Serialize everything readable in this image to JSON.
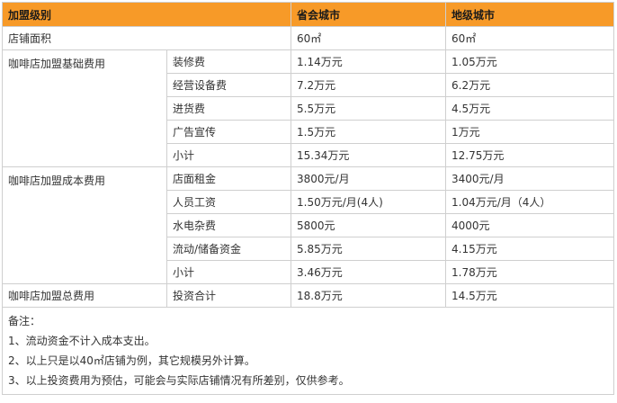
{
  "table": {
    "headers": [
      "加盟级别",
      "",
      "省会城市",
      "地级城市"
    ],
    "area": {
      "label": "店铺面积",
      "provincial": "60㎡",
      "prefecture": "60㎡"
    },
    "groups": [
      {
        "name": "咖啡店加盟基础费用",
        "rows": [
          {
            "item": "装修费",
            "provincial": "1.14万元",
            "prefecture": "1.05万元"
          },
          {
            "item": "经营设备费",
            "provincial": "7.2万元",
            "prefecture": "6.2万元"
          },
          {
            "item": "进货费",
            "provincial": "5.5万元",
            "prefecture": "4.5万元"
          },
          {
            "item": "广告宣传",
            "provincial": "1.5万元",
            "prefecture": "1万元"
          },
          {
            "item": "小计",
            "provincial": "15.34万元",
            "prefecture": "12.75万元"
          }
        ]
      },
      {
        "name": "咖啡店加盟成本费用",
        "rows": [
          {
            "item": "店面租金",
            "provincial": "3800元/月",
            "prefecture": "3400元/月"
          },
          {
            "item": "人员工资",
            "provincial": "1.50万元/月(4人)",
            "prefecture": "1.04万元/月（4人）"
          },
          {
            "item": "水电杂费",
            "provincial": "5800元",
            "prefecture": "4000元"
          },
          {
            "item": "流动/储备资金",
            "provincial": "5.85万元",
            "prefecture": "4.15万元"
          },
          {
            "item": "小计",
            "provincial": "3.46万元",
            "prefecture": "1.78万元"
          }
        ]
      },
      {
        "name": "咖啡店加盟总费用",
        "rows": [
          {
            "item": "投资合计",
            "provincial": "18.8万元",
            "prefecture": "14.5万元"
          }
        ]
      }
    ],
    "notes": {
      "title": "备注：",
      "lines": [
        "1、流动资金不计入成本支出。",
        "2、以上只是以40㎡店铺为例，其它规模另外计算。",
        "3、以上投资费用为预估，可能会与实际店铺情况有所差别，仅供参考。"
      ]
    },
    "colors": {
      "header_bg": "#f79a28",
      "border": "#cfcfcf",
      "text": "#333333"
    }
  }
}
